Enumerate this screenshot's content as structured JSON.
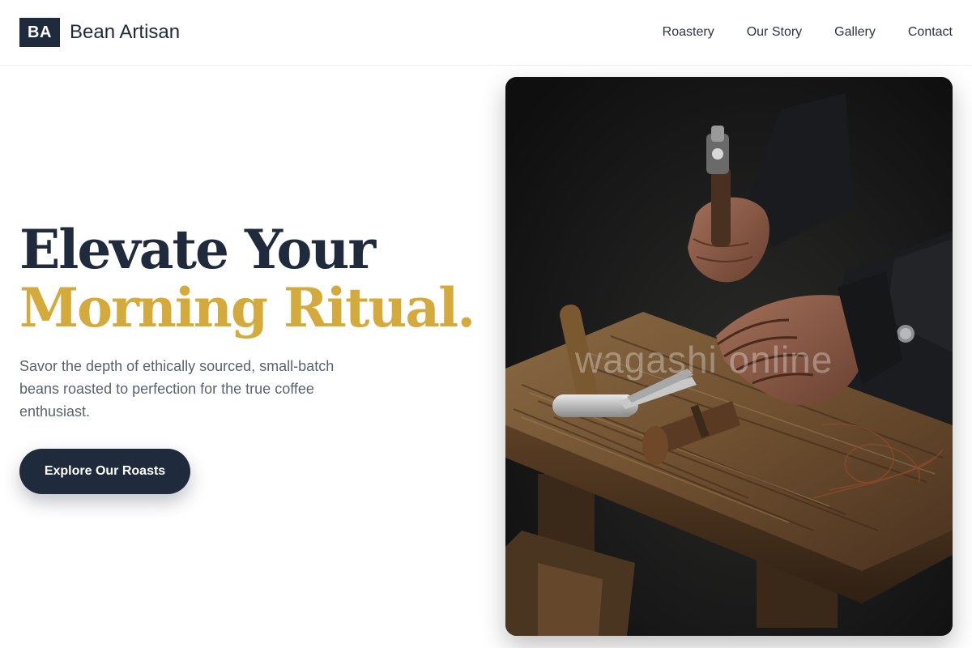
{
  "brand": {
    "logo_initials": "BA",
    "name": "Bean Artisan"
  },
  "nav": {
    "items": [
      {
        "label": "Roastery"
      },
      {
        "label": "Our Story"
      },
      {
        "label": "Gallery"
      },
      {
        "label": "Contact"
      }
    ]
  },
  "hero": {
    "title_line_1": "Elevate Your",
    "title_line_2": "Morning Ritual.",
    "subtitle": "Savor the depth of ethically sourced, small-batch beans roasted to perfection for the true coffee enthusiast.",
    "cta_label": "Explore Our Roasts",
    "image": {
      "subject": "craftsman hands with hammer and tools on weathered wooden workbench",
      "watermark": "wagashi online"
    }
  },
  "colors": {
    "navy": "#1f2a3d",
    "gold": "#d4aa3c",
    "text_muted": "#5a6270",
    "background": "#ffffff"
  }
}
